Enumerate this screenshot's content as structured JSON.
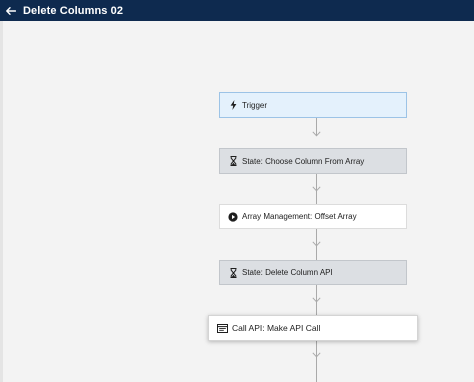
{
  "header": {
    "back_icon": "arrow-left-icon",
    "title": "Delete Columns 02"
  },
  "flow": {
    "nodes": [
      {
        "label": "Trigger",
        "icon": "lightning-bolt-icon"
      },
      {
        "label": "State: Choose Column From Array",
        "icon": "hourglass-icon"
      },
      {
        "label": "Array Management: Offset Array",
        "icon": "play-circle-icon"
      },
      {
        "label": "State: Delete Column API",
        "icon": "hourglass-icon"
      },
      {
        "label": "Call API: Make API Call",
        "icon": "api-window-icon"
      }
    ]
  },
  "colors": {
    "header_bg": "#0e2a4f",
    "trigger_bg": "#e4f1fc",
    "state_bg": "#dcdfe3",
    "canvas_bg": "#f3f3f3"
  }
}
